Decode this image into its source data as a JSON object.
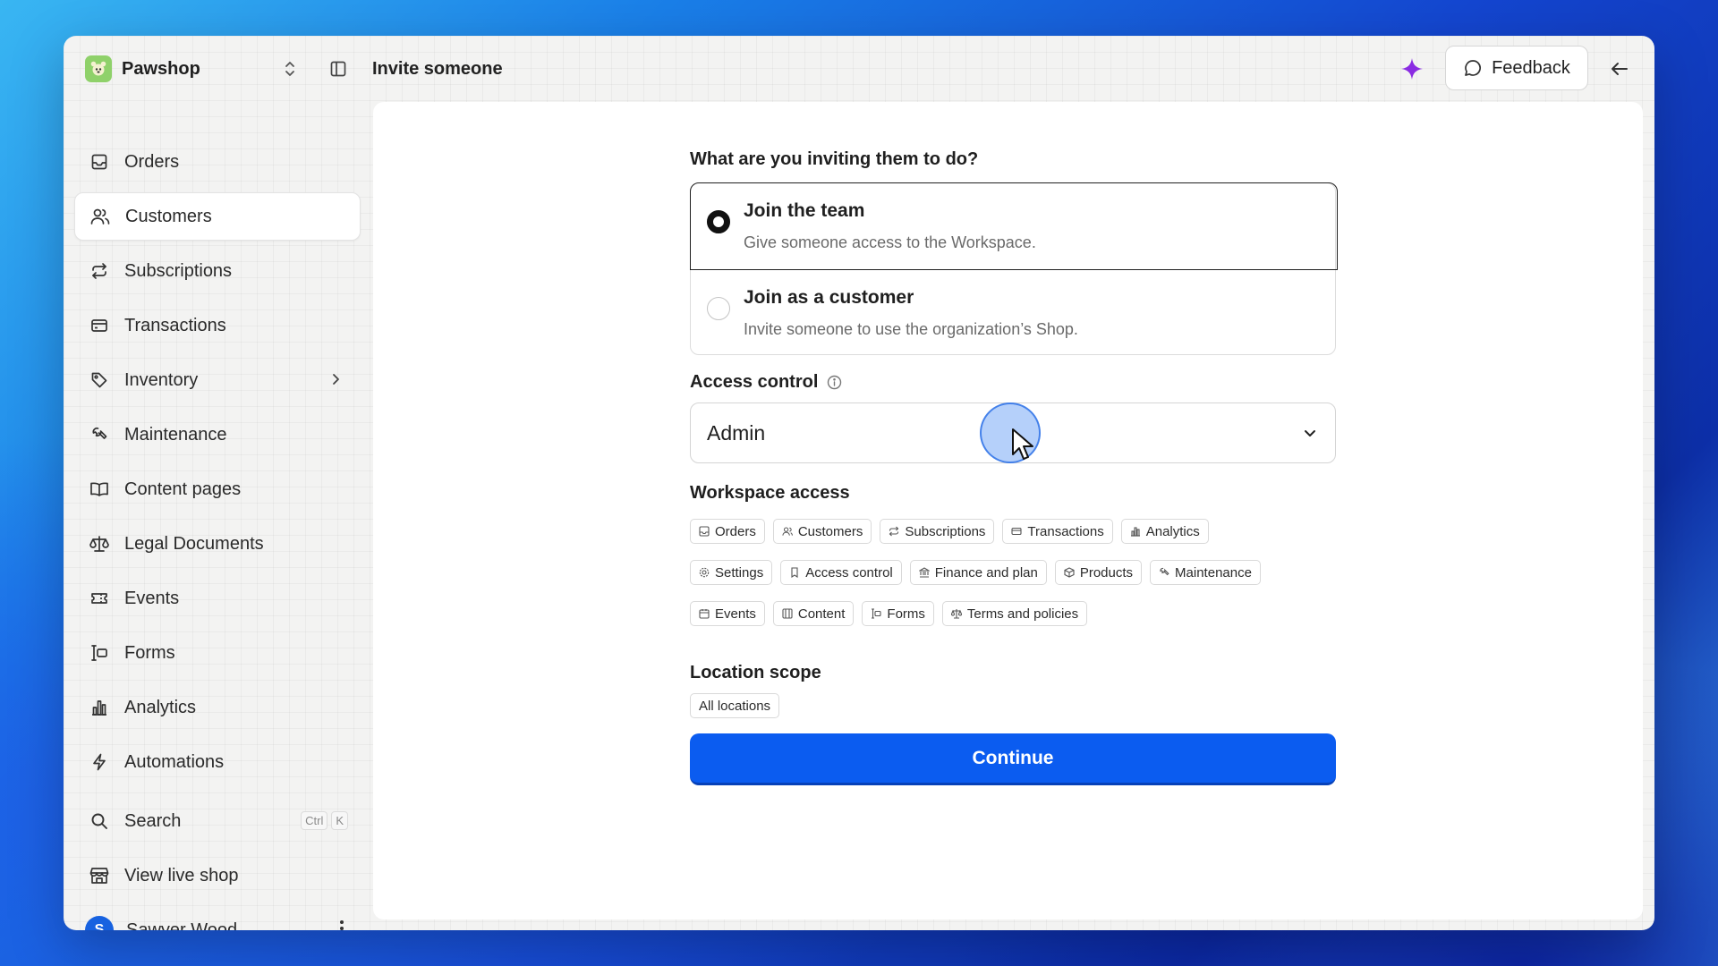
{
  "app": {
    "brand": "Pawshop",
    "page_title": "Invite someone",
    "feedback_label": "Feedback"
  },
  "sidebar": {
    "items": [
      {
        "label": "Orders",
        "icon": "inbox-icon"
      },
      {
        "label": "Customers",
        "icon": "users-icon",
        "active": true
      },
      {
        "label": "Subscriptions",
        "icon": "repeat-icon"
      },
      {
        "label": "Transactions",
        "icon": "credit-card-icon"
      },
      {
        "label": "Inventory",
        "icon": "tag-icon"
      },
      {
        "label": "Maintenance",
        "icon": "wrench-icon"
      },
      {
        "label": "Content pages",
        "icon": "book-icon"
      },
      {
        "label": "Legal Documents",
        "icon": "scale-icon"
      },
      {
        "label": "Events",
        "icon": "ticket-icon"
      },
      {
        "label": "Forms",
        "icon": "form-icon"
      },
      {
        "label": "Analytics",
        "icon": "bar-chart-icon"
      },
      {
        "label": "Automations",
        "icon": "bolt-icon"
      }
    ],
    "search": {
      "label": "Search",
      "kbd": [
        "Ctrl",
        "K"
      ]
    },
    "view_shop": "View live shop",
    "user": {
      "name": "Sawyer Wood",
      "initial": "S"
    }
  },
  "form": {
    "question": "What are you inviting them to do?",
    "options": [
      {
        "title": "Join the team",
        "desc": "Give someone access to the Workspace.",
        "selected": true
      },
      {
        "title": "Join as a customer",
        "desc": "Invite someone to use the organization’s Shop.",
        "selected": false
      }
    ],
    "access_control_label": "Access control",
    "access_control_value": "Admin",
    "workspace_access_label": "Workspace access",
    "workspace_access": [
      [
        "Orders",
        "Customers",
        "Subscriptions",
        "Transactions",
        "Analytics"
      ],
      [
        "Settings",
        "Access control",
        "Finance and plan",
        "Products",
        "Maintenance"
      ],
      [
        "Events",
        "Content",
        "Forms",
        "Terms and policies"
      ]
    ],
    "location_scope_label": "Location scope",
    "location_scope": "All locations",
    "continue_label": "Continue"
  },
  "colors": {
    "primary": "#0b5cf0",
    "brand_logo": "#8fd16a",
    "avatar": "#1762e0",
    "sparkle": "#8a2be2"
  }
}
